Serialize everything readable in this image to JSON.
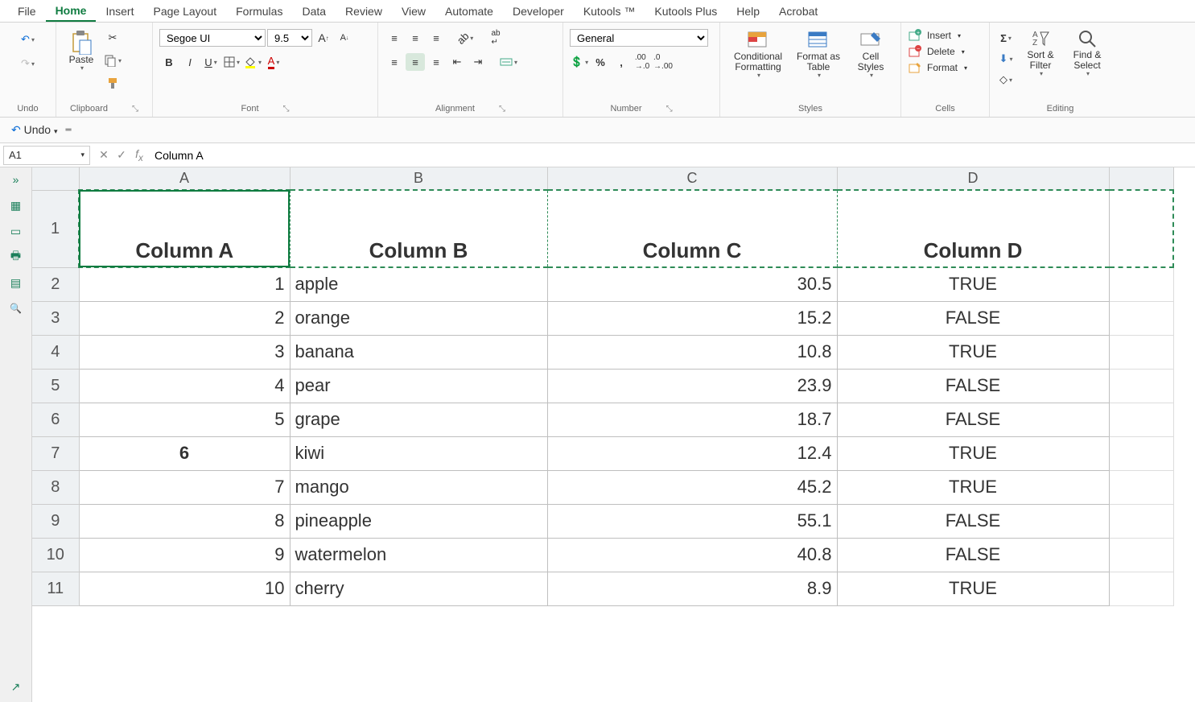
{
  "tabs": [
    "File",
    "Home",
    "Insert",
    "Page Layout",
    "Formulas",
    "Data",
    "Review",
    "View",
    "Automate",
    "Developer",
    "Kutools ™",
    "Kutools Plus",
    "Help",
    "Acrobat"
  ],
  "active_tab": "Home",
  "ribbon": {
    "undo": {
      "label": "Undo"
    },
    "clipboard": {
      "paste": "Paste",
      "label": "Clipboard"
    },
    "font": {
      "name": "Segoe UI",
      "size": "9.5",
      "label": "Font"
    },
    "alignment": {
      "label": "Alignment"
    },
    "number": {
      "format": "General",
      "label": "Number"
    },
    "styles": {
      "cond": "Conditional Formatting",
      "table": "Format as Table",
      "cell": "Cell Styles",
      "label": "Styles"
    },
    "cells": {
      "insert": "Insert",
      "delete": "Delete",
      "format": "Format",
      "label": "Cells"
    },
    "editing": {
      "sort": "Sort & Filter",
      "find": "Find & Select",
      "label": "Editing"
    }
  },
  "undo_bar": {
    "undo": "Undo"
  },
  "namebox": "A1",
  "formula": "Column A",
  "columns": [
    "A",
    "B",
    "C",
    "D"
  ],
  "rows": [
    "1",
    "2",
    "3",
    "4",
    "5",
    "6",
    "7",
    "8",
    "9",
    "10",
    "11"
  ],
  "headers": [
    "Column A",
    "Column B",
    "Column C",
    "Column D"
  ],
  "data": [
    {
      "a": "1",
      "b": "apple",
      "c": "30.5",
      "d": "TRUE"
    },
    {
      "a": "2",
      "b": "orange",
      "c": "15.2",
      "d": "FALSE"
    },
    {
      "a": "3",
      "b": "banana",
      "c": "10.8",
      "d": "TRUE"
    },
    {
      "a": "4",
      "b": "pear",
      "c": "23.9",
      "d": "FALSE"
    },
    {
      "a": "5",
      "b": "grape",
      "c": "18.7",
      "d": "FALSE"
    },
    {
      "a": "6",
      "b": "kiwi",
      "c": "12.4",
      "d": "TRUE",
      "bold": true
    },
    {
      "a": "7",
      "b": "mango",
      "c": "45.2",
      "d": "TRUE"
    },
    {
      "a": "8",
      "b": "pineapple",
      "c": "55.1",
      "d": "FALSE"
    },
    {
      "a": "9",
      "b": "watermelon",
      "c": "40.8",
      "d": "FALSE"
    },
    {
      "a": "10",
      "b": "cherry",
      "c": "8.9",
      "d": "TRUE"
    }
  ]
}
